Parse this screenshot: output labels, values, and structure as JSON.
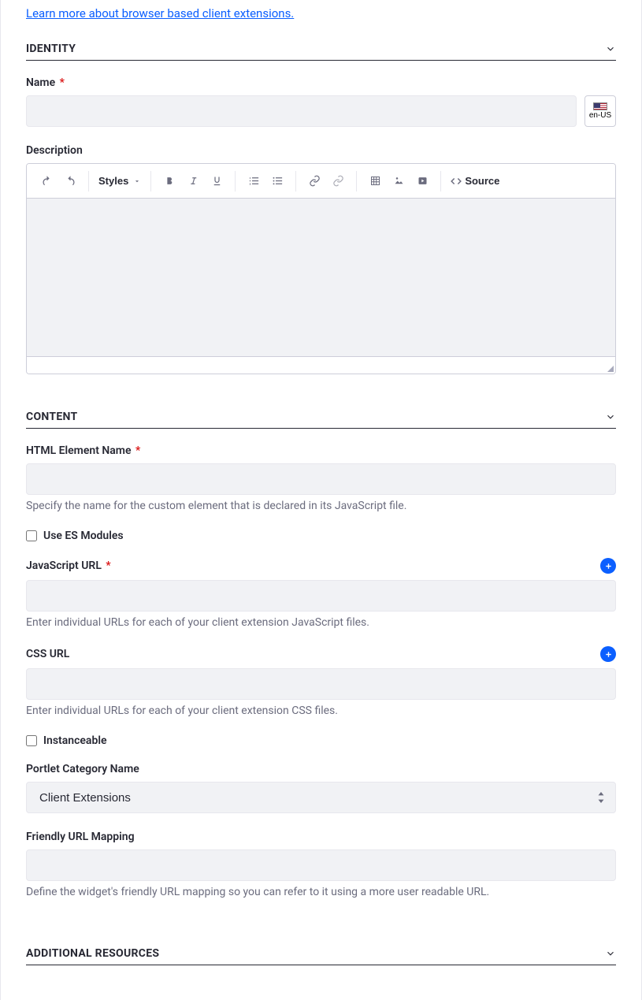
{
  "learn_link": "Learn more about browser based client extensions.",
  "sections": {
    "identity": "IDENTITY",
    "content": "CONTENT",
    "additional": "ADDITIONAL RESOURCES"
  },
  "identity": {
    "name_label": "Name",
    "required_mark": "*",
    "locale_code": "en-US",
    "description_label": "Description"
  },
  "toolbar": {
    "styles": "Styles",
    "source": "Source"
  },
  "content": {
    "html_element_label": "HTML Element Name",
    "html_element_help": "Specify the name for the custom element that is declared in its JavaScript file.",
    "es_modules_label": "Use ES Modules",
    "js_url_label": "JavaScript URL",
    "js_url_help": "Enter individual URLs for each of your client extension JavaScript files.",
    "css_url_label": "CSS URL",
    "css_url_help": "Enter individual URLs for each of your client extension CSS files.",
    "instanceable_label": "Instanceable",
    "portlet_category_label": "Portlet Category Name",
    "portlet_category_value": "Client Extensions",
    "friendly_url_label": "Friendly URL Mapping",
    "friendly_url_help": "Define the widget's friendly URL mapping so you can refer to it using a more user readable URL."
  }
}
